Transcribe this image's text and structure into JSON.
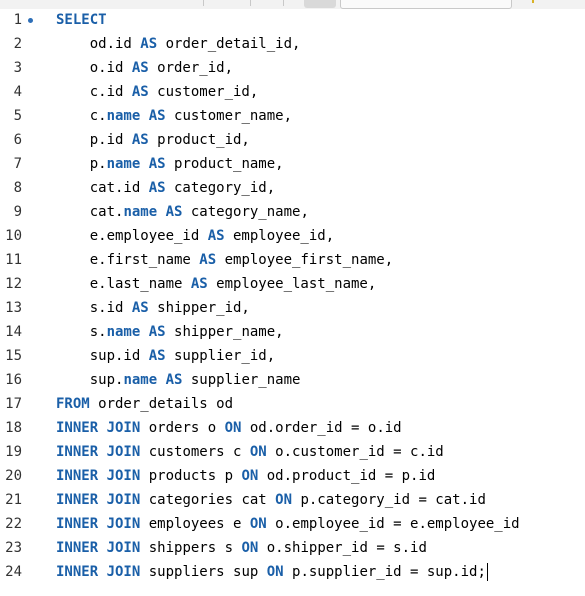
{
  "editor": {
    "lines": [
      {
        "number": "1",
        "segments": [
          [
            "kw",
            "SELECT"
          ]
        ]
      },
      {
        "number": "2",
        "segments": [
          [
            "t",
            "    od.id "
          ],
          [
            "kw",
            "AS"
          ],
          [
            "t",
            " order_detail_id,"
          ]
        ]
      },
      {
        "number": "3",
        "segments": [
          [
            "t",
            "    o.id "
          ],
          [
            "kw",
            "AS"
          ],
          [
            "t",
            " order_id,"
          ]
        ]
      },
      {
        "number": "4",
        "segments": [
          [
            "t",
            "    c.id "
          ],
          [
            "kw",
            "AS"
          ],
          [
            "t",
            " customer_id,"
          ]
        ]
      },
      {
        "number": "5",
        "segments": [
          [
            "t",
            "    c."
          ],
          [
            "fn",
            "name"
          ],
          [
            "t",
            " "
          ],
          [
            "kw",
            "AS"
          ],
          [
            "t",
            " customer_name,"
          ]
        ]
      },
      {
        "number": "6",
        "segments": [
          [
            "t",
            "    p.id "
          ],
          [
            "kw",
            "AS"
          ],
          [
            "t",
            " product_id,"
          ]
        ]
      },
      {
        "number": "7",
        "segments": [
          [
            "t",
            "    p."
          ],
          [
            "fn",
            "name"
          ],
          [
            "t",
            " "
          ],
          [
            "kw",
            "AS"
          ],
          [
            "t",
            " product_name,"
          ]
        ]
      },
      {
        "number": "8",
        "segments": [
          [
            "t",
            "    cat.id "
          ],
          [
            "kw",
            "AS"
          ],
          [
            "t",
            " category_id,"
          ]
        ]
      },
      {
        "number": "9",
        "segments": [
          [
            "t",
            "    cat."
          ],
          [
            "fn",
            "name"
          ],
          [
            "t",
            " "
          ],
          [
            "kw",
            "AS"
          ],
          [
            "t",
            " category_name,"
          ]
        ]
      },
      {
        "number": "10",
        "segments": [
          [
            "t",
            "    e.employee_id "
          ],
          [
            "kw",
            "AS"
          ],
          [
            "t",
            " employee_id,"
          ]
        ]
      },
      {
        "number": "11",
        "segments": [
          [
            "t",
            "    e.first_name "
          ],
          [
            "kw",
            "AS"
          ],
          [
            "t",
            " employee_first_name,"
          ]
        ]
      },
      {
        "number": "12",
        "segments": [
          [
            "t",
            "    e.last_name "
          ],
          [
            "kw",
            "AS"
          ],
          [
            "t",
            " employee_last_name,"
          ]
        ]
      },
      {
        "number": "13",
        "segments": [
          [
            "t",
            "    s.id "
          ],
          [
            "kw",
            "AS"
          ],
          [
            "t",
            " shipper_id,"
          ]
        ]
      },
      {
        "number": "14",
        "segments": [
          [
            "t",
            "    s."
          ],
          [
            "fn",
            "name"
          ],
          [
            "t",
            " "
          ],
          [
            "kw",
            "AS"
          ],
          [
            "t",
            " shipper_name,"
          ]
        ]
      },
      {
        "number": "15",
        "segments": [
          [
            "t",
            "    sup.id "
          ],
          [
            "kw",
            "AS"
          ],
          [
            "t",
            " supplier_id,"
          ]
        ]
      },
      {
        "number": "16",
        "segments": [
          [
            "t",
            "    sup."
          ],
          [
            "fn",
            "name"
          ],
          [
            "t",
            " "
          ],
          [
            "kw",
            "AS"
          ],
          [
            "t",
            " supplier_name"
          ]
        ]
      },
      {
        "number": "17",
        "segments": [
          [
            "kw",
            "FROM"
          ],
          [
            "t",
            " order_details od"
          ]
        ]
      },
      {
        "number": "18",
        "segments": [
          [
            "kw",
            "INNER JOIN"
          ],
          [
            "t",
            " orders o "
          ],
          [
            "kw",
            "ON"
          ],
          [
            "t",
            " od.order_id = o.id"
          ]
        ]
      },
      {
        "number": "19",
        "segments": [
          [
            "kw",
            "INNER JOIN"
          ],
          [
            "t",
            " customers c "
          ],
          [
            "kw",
            "ON"
          ],
          [
            "t",
            " o.customer_id = c.id"
          ]
        ]
      },
      {
        "number": "20",
        "segments": [
          [
            "kw",
            "INNER JOIN"
          ],
          [
            "t",
            " products p "
          ],
          [
            "kw",
            "ON"
          ],
          [
            "t",
            " od.product_id = p.id"
          ]
        ]
      },
      {
        "number": "21",
        "segments": [
          [
            "kw",
            "INNER JOIN"
          ],
          [
            "t",
            " categories cat "
          ],
          [
            "kw",
            "ON"
          ],
          [
            "t",
            " p.category_id = cat.id"
          ]
        ]
      },
      {
        "number": "22",
        "segments": [
          [
            "kw",
            "INNER JOIN"
          ],
          [
            "t",
            " employees e "
          ],
          [
            "kw",
            "ON"
          ],
          [
            "t",
            " o.employee_id = e.employee_id"
          ]
        ]
      },
      {
        "number": "23",
        "segments": [
          [
            "kw",
            "INNER JOIN"
          ],
          [
            "t",
            " shippers s "
          ],
          [
            "kw",
            "ON"
          ],
          [
            "t",
            " o.shipper_id = s.id"
          ]
        ]
      },
      {
        "number": "24",
        "segments": [
          [
            "kw",
            "INNER JOIN"
          ],
          [
            "t",
            " suppliers sup "
          ],
          [
            "kw",
            "ON"
          ],
          [
            "t",
            " p.supplier_id = sup.id;"
          ]
        ]
      }
    ],
    "current_line_marker": "1",
    "cursor_line": "24",
    "colors": {
      "keyword": "#1a5fa8",
      "text": "#000000",
      "gutter": "#333333",
      "marker": "#2e6fb8"
    }
  }
}
